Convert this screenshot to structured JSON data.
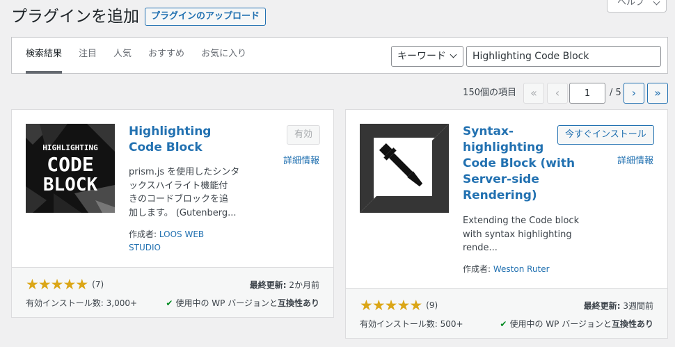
{
  "header": {
    "title": "プラグインを追加",
    "upload_label": "プラグインのアップロード",
    "help_label": "ヘルプ"
  },
  "filters": {
    "tabs": [
      "検索結果",
      "注目",
      "人気",
      "おすすめ",
      "お気に入り"
    ],
    "search_type": "キーワード",
    "search_value": "Highlighting Code Block"
  },
  "pagination": {
    "count": "150個の項目",
    "first": "«",
    "prev": "‹",
    "current": "1",
    "total": "/ 5",
    "next": "›",
    "last": "»"
  },
  "plugins": [
    {
      "name_lines": [
        "Highlighting",
        "Code Block"
      ],
      "icon_text": [
        "HIGHLIGHTING",
        "CODE",
        "BLOCK"
      ],
      "action": "有効",
      "details": "詳細情報",
      "desc_lines": [
        "prism.js を使用したシンタ",
        "ックスハイライト機能付",
        "きのコードブロックを追",
        "加します。 (Gutenberg..."
      ],
      "author_label": "作成者:",
      "author_lines": [
        "LOOS WEB",
        "STUDIO"
      ],
      "rating": 5,
      "rating_count": "(7)",
      "installs": "有効インストール数: 3,000+",
      "updated_label": "最終更新:",
      "updated": "2か月前",
      "compat_prefix": "使用中の WP バージョンと",
      "compat_bold": "互換性あり"
    },
    {
      "name_lines": [
        "Syntax-",
        "highlighting",
        "Code Block (with",
        "Server-side",
        "Rendering)"
      ],
      "action": "今すぐインストール",
      "details": "詳細情報",
      "desc_lines": [
        "Extending the Code block",
        "with syntax highlighting",
        "rende..."
      ],
      "author_label": "作成者:",
      "author_lines": [
        "Weston Ruter"
      ],
      "rating": 5,
      "rating_count": "(9)",
      "installs": "有効インストール数: 500+",
      "updated_label": "最終更新:",
      "updated": "3週間前",
      "compat_prefix": "使用中の WP バージョンと",
      "compat_bold": "互換性あり"
    }
  ],
  "colors": {
    "accent": "#2271b1",
    "star": "#dba617",
    "check": "#008a20"
  }
}
